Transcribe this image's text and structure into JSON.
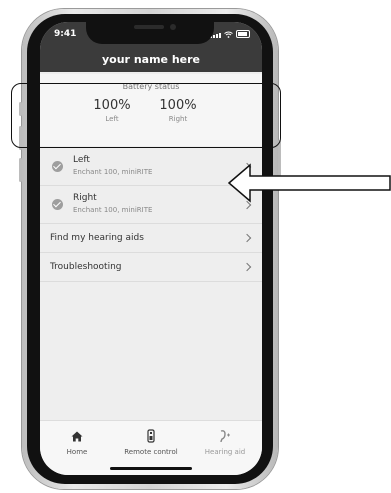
{
  "status_bar": {
    "time": "9:41"
  },
  "header": {
    "title": "your name here"
  },
  "battery": {
    "title": "Battery status",
    "left_value": "100%",
    "left_label": "Left",
    "right_value": "100%",
    "right_label": "Right"
  },
  "devices": [
    {
      "name": "Left",
      "model": "Enchant 100, miniRITE"
    },
    {
      "name": "Right",
      "model": "Enchant 100, miniRITE"
    }
  ],
  "menu": {
    "find": "Find my hearing aids",
    "troubleshooting": "Troubleshooting"
  },
  "tabs": [
    {
      "label": "Home",
      "icon": "home-icon"
    },
    {
      "label": "Remote control",
      "icon": "remote-control-icon"
    },
    {
      "label": "Hearing aid",
      "icon": "hearing-aid-icon"
    }
  ],
  "colors": {
    "header_bg": "#3b3b3b",
    "screen_bg": "#eeeeee",
    "accent": "#111111"
  }
}
